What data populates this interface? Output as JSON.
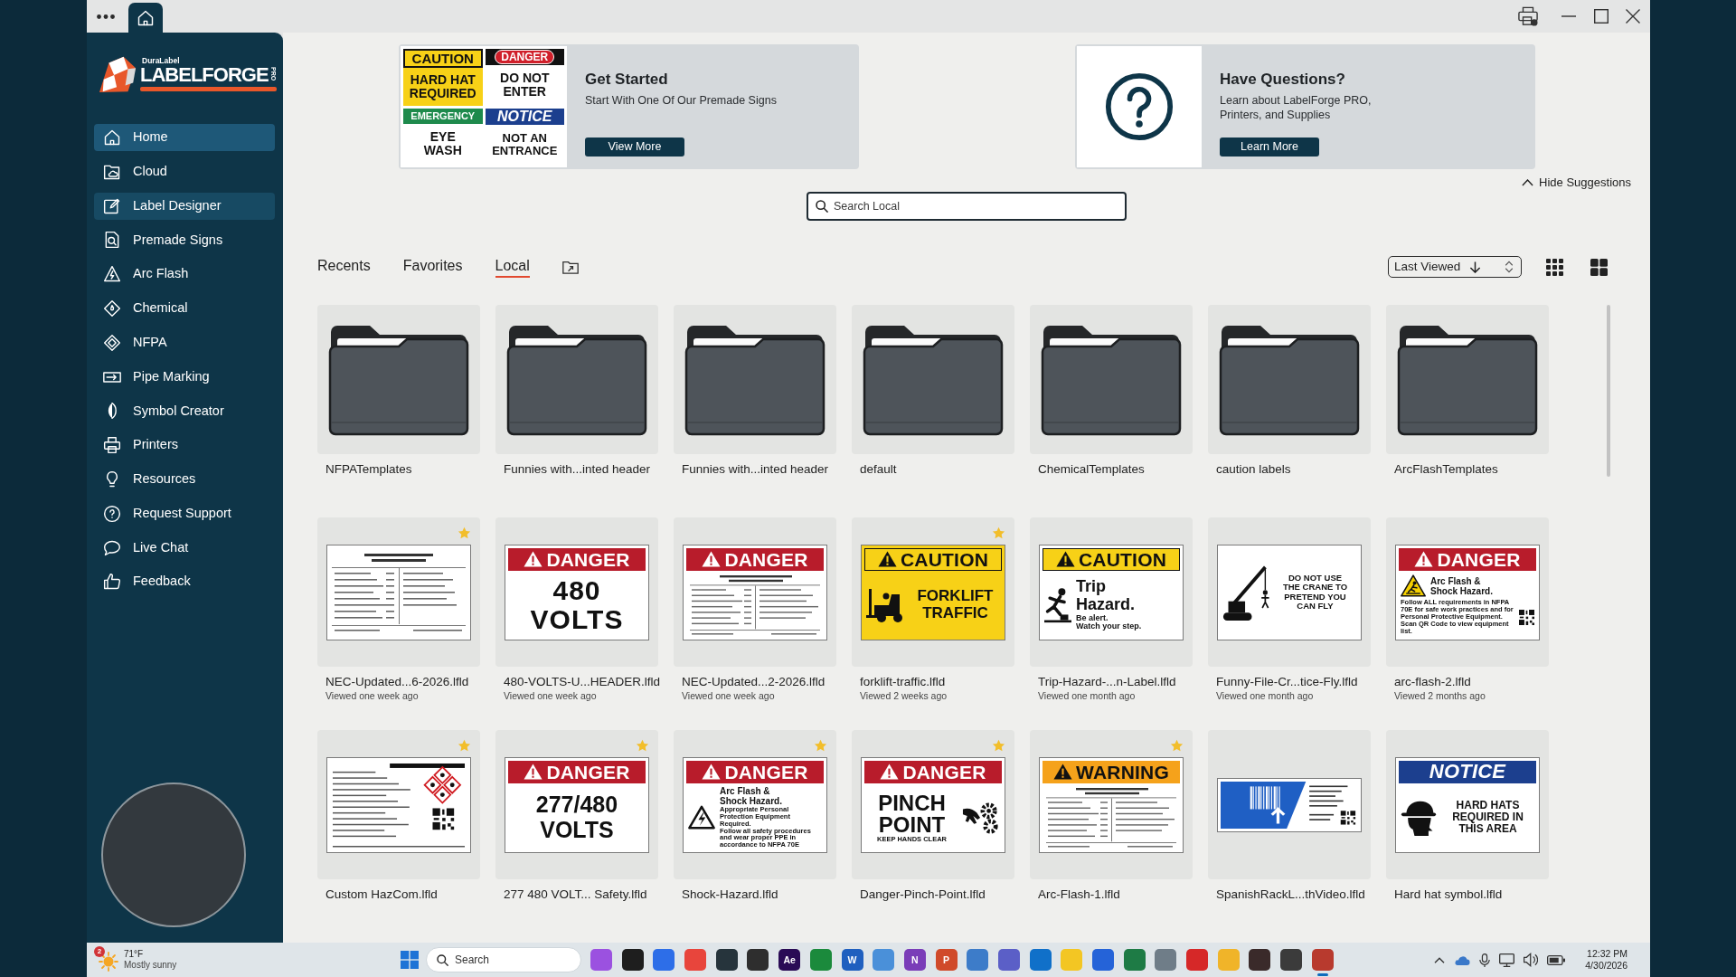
{
  "sidebar": {
    "logo": {
      "brand": "DuraLabel",
      "name": "LABELFORGE",
      "edition": "PRO"
    },
    "items": [
      {
        "label": "Home",
        "selected": true,
        "hovered": false
      },
      {
        "label": "Cloud",
        "selected": false,
        "hovered": false
      },
      {
        "label": "Label Designer",
        "selected": false,
        "hovered": true
      },
      {
        "label": "Premade Signs",
        "selected": false,
        "hovered": false
      },
      {
        "label": "Arc Flash",
        "selected": false,
        "hovered": false
      },
      {
        "label": "Chemical",
        "selected": false,
        "hovered": false
      },
      {
        "label": "NFPA",
        "selected": false,
        "hovered": false
      },
      {
        "label": "Pipe Marking",
        "selected": false,
        "hovered": false
      },
      {
        "label": "Symbol Creator",
        "selected": false,
        "hovered": false
      },
      {
        "label": "Printers",
        "selected": false,
        "hovered": false
      },
      {
        "label": "Resources",
        "selected": false,
        "hovered": false
      },
      {
        "label": "Request Support",
        "selected": false,
        "hovered": false
      },
      {
        "label": "Live Chat",
        "selected": false,
        "hovered": false
      },
      {
        "label": "Feedback",
        "selected": false,
        "hovered": false
      }
    ]
  },
  "suggestions": [
    {
      "kind": "signs",
      "title": "Get Started",
      "text": "Start With One Of Our Premade Signs",
      "button": "View More",
      "signs": [
        {
          "kind": "caution",
          "header": "CAUTION",
          "lines": [
            "HARD HAT",
            "REQUIRED"
          ]
        },
        {
          "kind": "danger",
          "header": "DANGER",
          "lines": [
            "DO NOT",
            "ENTER"
          ]
        },
        {
          "kind": "emergency",
          "header": "EMERGENCY",
          "lines": [
            "EYE",
            "WASH"
          ]
        },
        {
          "kind": "notice",
          "header": "NOTICE",
          "lines": [
            "NOT AN",
            "ENTRANCE"
          ]
        }
      ]
    },
    {
      "kind": "help",
      "title": "Have Questions?",
      "text": "Learn about LabelForge PRO, Printers, and Supplies",
      "button": "Learn More"
    }
  ],
  "hide_suggestions": "Hide Suggestions",
  "search": {
    "placeholder": "Search Local"
  },
  "tabs": [
    {
      "label": "Recents",
      "selected": false
    },
    {
      "label": "Favorites",
      "selected": false
    },
    {
      "label": "Local",
      "selected": true
    }
  ],
  "sort": {
    "value": "Last Viewed"
  },
  "folders": [
    {
      "name": "NFPATemplates"
    },
    {
      "name": "Funnies with...inted header"
    },
    {
      "name": "Funnies with...inted header"
    },
    {
      "name": "default"
    },
    {
      "name": "ChemicalTemplates"
    },
    {
      "name": "caution labels"
    },
    {
      "name": "ArcFlashTemplates"
    }
  ],
  "files": [
    {
      "name": "NEC-Updated...6-2026.lfld",
      "viewed": "Viewed one week ago",
      "favorite": true,
      "thumbnail": {
        "kind": "document"
      }
    },
    {
      "name": "480-VOLTS-U...HEADER.lfld",
      "viewed": "Viewed one week ago",
      "favorite": false,
      "thumbnail": {
        "kind": "sign",
        "filled": false,
        "header": {
          "kind": "danger",
          "text": "DANGER"
        },
        "lines": [
          "480",
          "VOLTS"
        ]
      }
    },
    {
      "name": "NEC-Updated...2-2026.lfld",
      "viewed": "Viewed one week ago",
      "favorite": false,
      "thumbnail": {
        "kind": "sign",
        "filled": false,
        "header": {
          "kind": "danger",
          "text": "DANGER"
        }
      }
    },
    {
      "name": "forklift-traffic.lfld",
      "viewed": "Viewed 2 weeks ago",
      "favorite": true,
      "thumbnail": {
        "kind": "sign",
        "filled": true,
        "header": {
          "kind": "caution",
          "text": "CAUTION"
        },
        "lines": [
          "FORKLIFT",
          "TRAFFIC"
        ]
      }
    },
    {
      "name": "Trip-Hazard-...n-Label.lfld",
      "viewed": "Viewed one month ago",
      "favorite": false,
      "thumbnail": {
        "kind": "sign",
        "filled": false,
        "header": {
          "kind": "caution",
          "text": "CAUTION"
        },
        "lines": [
          "Trip",
          "Hazard."
        ],
        "notes": [
          "Be alert.",
          "Watch your step."
        ]
      }
    },
    {
      "name": "Funny-File-Cr...tice-Fly.lfld",
      "viewed": "Viewed one month ago",
      "favorite": false,
      "thumbnail": {
        "kind": "sign",
        "filled": false,
        "lines": [
          "DO NOT USE",
          "THE CRANE TO",
          "PRETEND YOU",
          "CAN FLY"
        ]
      }
    },
    {
      "name": "arc-flash-2.lfld",
      "viewed": "Viewed 2 months ago",
      "favorite": false,
      "thumbnail": {
        "kind": "sign",
        "filled": false,
        "header": {
          "kind": "danger",
          "text": "DANGER"
        },
        "lines": [
          "Arc Flash &",
          "Shock Hazard."
        ],
        "notes": [
          "Follow ALL requirements in NFPA 70E for safe work practices and for Personal Protective Equipment. Scan QR Code to view equipment list."
        ]
      }
    },
    {
      "name": "Custom HazCom.lfld",
      "favorite": true,
      "thumbnail": {
        "kind": "document"
      }
    },
    {
      "name": "277 480 VOLT... Safety.lfld",
      "favorite": true,
      "thumbnail": {
        "kind": "sign",
        "filled": false,
        "header": {
          "kind": "danger",
          "text": "DANGER"
        },
        "lines": [
          "277/480",
          "VOLTS"
        ]
      }
    },
    {
      "name": "Shock-Hazard.lfld",
      "favorite": true,
      "thumbnail": {
        "kind": "sign",
        "filled": false,
        "header": {
          "kind": "danger",
          "text": "DANGER"
        },
        "lines": [
          "Arc Flash &",
          "Shock Hazard."
        ],
        "notes": [
          "Appropriate Personal Protection Equipment Required.",
          "Follow all safety procedures and wear proper PPE in accordance to NFPA 70E"
        ]
      }
    },
    {
      "name": "Danger-Pinch-Point.lfld",
      "favorite": true,
      "thumbnail": {
        "kind": "sign",
        "filled": false,
        "header": {
          "kind": "danger",
          "text": "DANGER"
        },
        "lines": [
          "PINCH",
          "POINT"
        ],
        "notes": [
          "KEEP HANDS CLEAR"
        ]
      }
    },
    {
      "name": "Arc-Flash-1.lfld",
      "favorite": true,
      "thumbnail": {
        "kind": "sign",
        "filled": false,
        "header": {
          "kind": "warning",
          "text": "WARNING"
        }
      }
    },
    {
      "name": "SpanishRackL...thVideo.lfld",
      "favorite": false,
      "thumbnail": {
        "kind": "document"
      }
    },
    {
      "name": "Hard hat symbol.lfld",
      "favorite": false,
      "thumbnail": {
        "kind": "sign",
        "filled": false,
        "header": {
          "kind": "notice",
          "text": "NOTICE"
        },
        "lines": [
          "HARD HATS",
          "REQUIRED IN",
          "THIS AREA"
        ]
      }
    }
  ],
  "taskbar": {
    "weather": {
      "temperature": "71°F",
      "condition": "Mostly sunny",
      "badge": "2"
    },
    "search": {
      "placeholder": "Search"
    },
    "apps": [
      {
        "color": "#9b51e0",
        "active": false
      },
      {
        "color": "#1e1e1e",
        "active": false
      },
      {
        "color": "#2d6ee8",
        "active": false
      },
      {
        "color": "#e8453c",
        "active": false
      },
      {
        "color": "#26343c",
        "active": false
      },
      {
        "color": "#2e2e2e",
        "active": false
      },
      {
        "color": "#2a0b55",
        "glyph": "Ae",
        "active": false
      },
      {
        "color": "#1b8a3c",
        "active": false
      },
      {
        "color": "#1f5fbf",
        "glyph": "W",
        "active": false
      },
      {
        "color": "#4a90d9",
        "active": false
      },
      {
        "color": "#7a3db8",
        "glyph": "N",
        "active": false
      },
      {
        "color": "#d04a2a",
        "glyph": "P",
        "active": false
      },
      {
        "color": "#3d7cc9",
        "active": false
      },
      {
        "color": "#5b5fc7",
        "active": false
      },
      {
        "color": "#1070c9",
        "active": false
      },
      {
        "color": "#f3c623",
        "active": false
      },
      {
        "color": "#2563d8",
        "active": false
      },
      {
        "color": "#1e7b45",
        "active": false
      },
      {
        "color": "#6f7d88",
        "active": false
      },
      {
        "color": "#d62828",
        "active": false
      },
      {
        "color": "#f0b429",
        "active": false
      },
      {
        "color": "#3a2a2a",
        "active": false
      },
      {
        "color": "#3b3b3b",
        "active": false
      },
      {
        "color": "#b83a2e",
        "active": true
      }
    ],
    "clock": {
      "time": "12:32 PM",
      "date": "4/30/2026"
    }
  }
}
